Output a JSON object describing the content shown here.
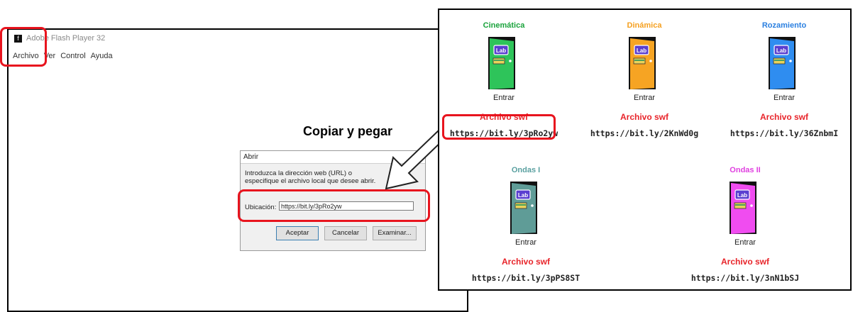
{
  "flash_player": {
    "title": "Adobe Flash Player 32",
    "logo_glyph": "f",
    "menu": [
      "Archivo",
      "Ver",
      "Control",
      "Ayuda"
    ]
  },
  "dialog": {
    "title": "Abrir",
    "description": "Introduzca la dirección web (URL) o especifique el archivo local que desee abrir.",
    "location_label": "Ubicación:",
    "location_value": "https://bit.ly/3pRo2yw",
    "buttons": {
      "ok": "Aceptar",
      "cancel": "Cancelar",
      "browse": "Examinar..."
    }
  },
  "annotation": {
    "copy_paste": "Copiar y pegar"
  },
  "labs": [
    {
      "name": "Cinemática",
      "name_color": "#1aa33c",
      "door_color": "#2ec45a",
      "enter": "Entrar",
      "swf_label": "Archivo swf",
      "url": "https://bit.ly/3pRo2yw"
    },
    {
      "name": "Dinámica",
      "name_color": "#f5a020",
      "door_color": "#f6a423",
      "enter": "Entrar",
      "swf_label": "Archivo swf",
      "url": "https://bit.ly/2KnWd0g"
    },
    {
      "name": "Rozamiento",
      "name_color": "#2a7fe0",
      "door_color": "#2f8df0",
      "enter": "Entrar",
      "swf_label": "Archivo swf",
      "url": "https://bit.ly/36ZnbmI"
    },
    {
      "name": "Ondas I",
      "name_color": "#5aa0a0",
      "door_color": "#5f9c97",
      "enter": "Entrar",
      "swf_label": "Archivo swf",
      "url": "https://bit.ly/3pPS8ST"
    },
    {
      "name": "Ondas II",
      "name_color": "#e040e0",
      "door_color": "#f04cf0",
      "enter": "Entrar",
      "swf_label": "Archivo swf",
      "url": "https://bit.ly/3nN1bSJ"
    }
  ],
  "door_badge": "Lab",
  "highlight_color": "#e8141e"
}
